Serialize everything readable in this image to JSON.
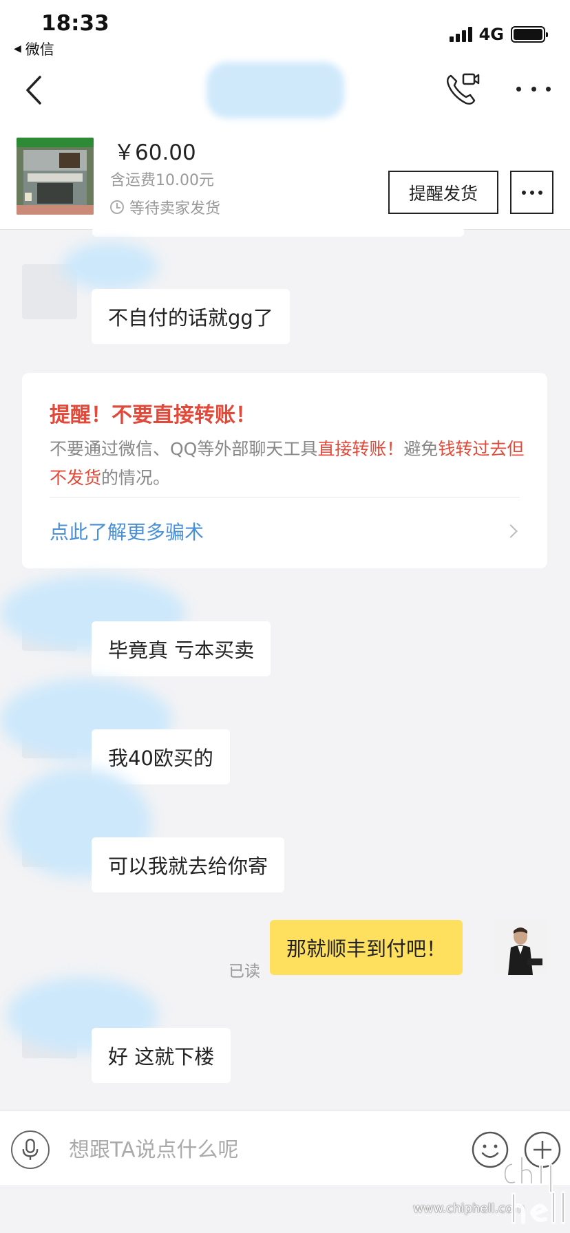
{
  "status_bar": {
    "time": "18:33",
    "back_app": "微信",
    "network": "4G"
  },
  "nav": {
    "back_icon": "chevron-left-icon",
    "call_icon": "phone-icon",
    "more_icon": "more-icon"
  },
  "order": {
    "price": "￥60.00",
    "shipping": "含运费10.00元",
    "status": "等待卖家发货",
    "remind_label": "提醒发货"
  },
  "messages": [
    {
      "from": "other",
      "text": "不自付的话就gg了"
    },
    {
      "from": "other",
      "text": "毕竟真  亏本买卖"
    },
    {
      "from": "other",
      "text": "我40欧买的"
    },
    {
      "from": "other",
      "text": "可以我就去给你寄"
    },
    {
      "from": "me",
      "text": "那就顺丰到付吧！",
      "read": "已读"
    },
    {
      "from": "other",
      "text": "好  这就下楼"
    }
  ],
  "warning": {
    "title": "提醒！不要直接转账！",
    "body_1": "不要通过微信、QQ等外部聊天工具",
    "body_red_1": "直接转账！",
    "body_2": "避免",
    "body_red_2": "钱转过去但不发货",
    "body_3": "的情况。",
    "link": "点此了解更多骗术"
  },
  "input": {
    "placeholder": "想跟TA说点什么呢"
  },
  "watermark": {
    "url": "www.chiphell.com"
  },
  "colors": {
    "warning_red": "#e04a3b",
    "link_blue": "#4a90d6",
    "my_bubble": "#ffdf5e",
    "background": "#f3f3f5"
  }
}
